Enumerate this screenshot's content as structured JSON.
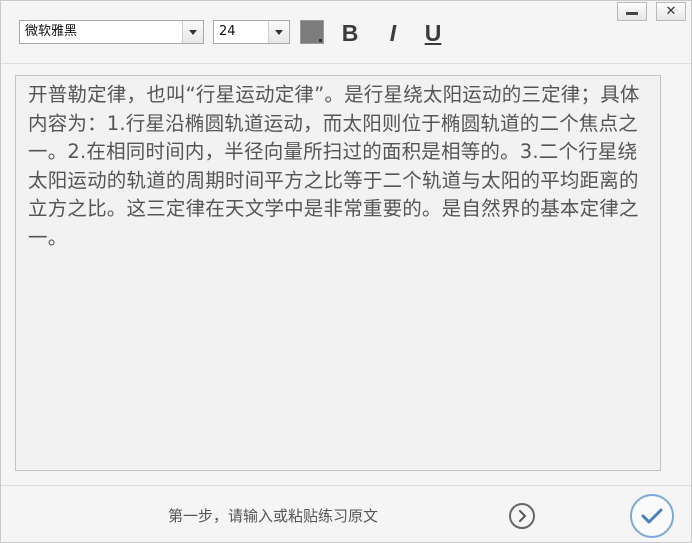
{
  "toolbar": {
    "font_name": "微软雅黑",
    "font_size": "24",
    "text_color": "#7c7c7c",
    "bold_label": "B",
    "italic_label": "I",
    "underline_label": "U"
  },
  "window": {
    "minimize_icon": "minimize-icon",
    "close_label": "✕"
  },
  "editor": {
    "text": "开普勒定律，也叫“行星运动定律”。是行星绕太阳运动的三定律；具体内容为：1.行星沿椭圆轨道运动，而太阳则位于椭圆轨道的二个焦点之一。2.在相同时间内，半径向量所扫过的面积是相等的。3.二个行星绕太阳运动的轨道的周期时间平方之比等于二个轨道与太阳的平均距离的立方之比。这三定律在天文学中是非常重要的。是自然界的基本定律之一。"
  },
  "footer": {
    "step_hint": "第一步，请输入或粘贴练习原文",
    "next_icon": "chevron-right-circle-icon",
    "confirm_icon": "checkmark-icon",
    "accent_color": "#4a7fc1"
  }
}
